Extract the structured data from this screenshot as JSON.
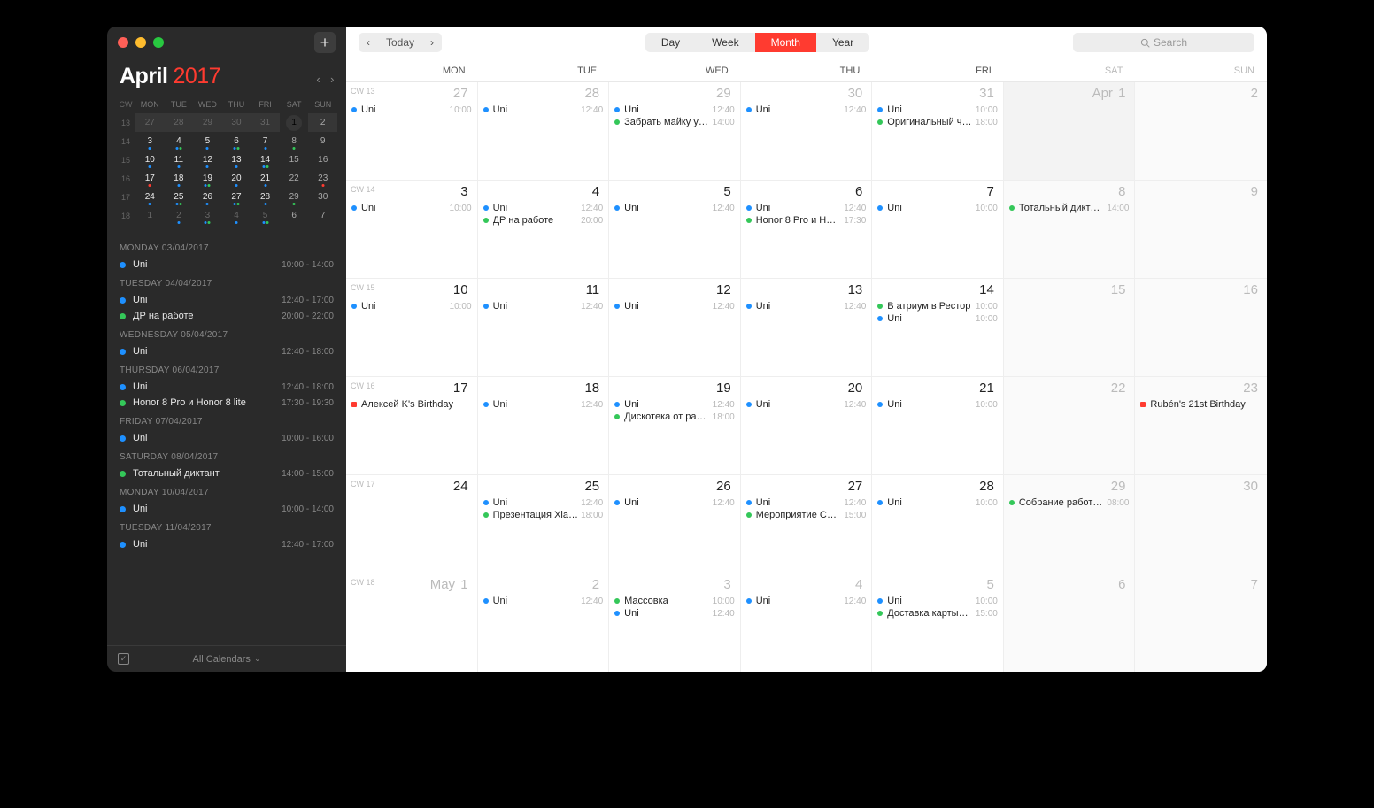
{
  "sidebar": {
    "month": "April",
    "year": "2017",
    "mini_header": [
      "CW",
      "MON",
      "TUE",
      "WED",
      "THU",
      "FRI",
      "SAT",
      "SUN"
    ],
    "mini_rows": [
      {
        "cw": "13",
        "days": [
          {
            "n": "27",
            "out": true,
            "dots": []
          },
          {
            "n": "28",
            "out": true,
            "dots": []
          },
          {
            "n": "29",
            "out": true,
            "dots": []
          },
          {
            "n": "30",
            "out": true,
            "dots": []
          },
          {
            "n": "31",
            "out": true,
            "dots": []
          },
          {
            "n": "1",
            "today": true,
            "dots": []
          },
          {
            "n": "2",
            "wknd": true,
            "dots": []
          }
        ],
        "sel": true
      },
      {
        "cw": "14",
        "days": [
          {
            "n": "3",
            "dots": [
              "#1e90ff"
            ]
          },
          {
            "n": "4",
            "dots": [
              "#1e90ff",
              "#34c759"
            ]
          },
          {
            "n": "5",
            "dots": [
              "#1e90ff"
            ]
          },
          {
            "n": "6",
            "dots": [
              "#1e90ff",
              "#34c759"
            ]
          },
          {
            "n": "7",
            "dots": [
              "#1e90ff"
            ]
          },
          {
            "n": "8",
            "wknd": true,
            "dots": [
              "#34c759"
            ]
          },
          {
            "n": "9",
            "wknd": true,
            "dots": []
          }
        ]
      },
      {
        "cw": "15",
        "days": [
          {
            "n": "10",
            "dots": [
              "#1e90ff"
            ]
          },
          {
            "n": "11",
            "dots": [
              "#1e90ff"
            ]
          },
          {
            "n": "12",
            "dots": [
              "#1e90ff"
            ]
          },
          {
            "n": "13",
            "dots": [
              "#1e90ff"
            ]
          },
          {
            "n": "14",
            "dots": [
              "#1e90ff",
              "#34c759"
            ]
          },
          {
            "n": "15",
            "wknd": true,
            "dots": []
          },
          {
            "n": "16",
            "wknd": true,
            "dots": []
          }
        ]
      },
      {
        "cw": "16",
        "days": [
          {
            "n": "17",
            "dots": [
              "#ff3b30"
            ]
          },
          {
            "n": "18",
            "dots": [
              "#1e90ff"
            ]
          },
          {
            "n": "19",
            "dots": [
              "#1e90ff",
              "#34c759"
            ]
          },
          {
            "n": "20",
            "dots": [
              "#1e90ff"
            ]
          },
          {
            "n": "21",
            "dots": [
              "#1e90ff"
            ]
          },
          {
            "n": "22",
            "wknd": true,
            "dots": []
          },
          {
            "n": "23",
            "wknd": true,
            "dots": [
              "#ff3b30"
            ]
          }
        ]
      },
      {
        "cw": "17",
        "days": [
          {
            "n": "24",
            "dots": [
              "#1e90ff"
            ]
          },
          {
            "n": "25",
            "dots": [
              "#1e90ff",
              "#34c759"
            ]
          },
          {
            "n": "26",
            "dots": [
              "#1e90ff"
            ]
          },
          {
            "n": "27",
            "dots": [
              "#1e90ff",
              "#34c759"
            ]
          },
          {
            "n": "28",
            "dots": [
              "#1e90ff"
            ]
          },
          {
            "n": "29",
            "wknd": true,
            "dots": [
              "#34c759"
            ]
          },
          {
            "n": "30",
            "wknd": true,
            "dots": []
          }
        ]
      },
      {
        "cw": "18",
        "days": [
          {
            "n": "1",
            "out": true,
            "dots": []
          },
          {
            "n": "2",
            "out": true,
            "dots": [
              "#1e90ff"
            ]
          },
          {
            "n": "3",
            "out": true,
            "dots": [
              "#1e90ff",
              "#34c759"
            ]
          },
          {
            "n": "4",
            "out": true,
            "dots": [
              "#1e90ff"
            ]
          },
          {
            "n": "5",
            "out": true,
            "dots": [
              "#1e90ff",
              "#34c759"
            ]
          },
          {
            "n": "6",
            "out": true,
            "wknd": true,
            "dots": []
          },
          {
            "n": "7",
            "out": true,
            "wknd": true,
            "dots": []
          }
        ]
      }
    ],
    "agenda": [
      {
        "type": "h",
        "text": "MONDAY 03/04/2017"
      },
      {
        "type": "e",
        "color": "#1e90ff",
        "label": "Uni",
        "time": "10:00 - 14:00"
      },
      {
        "type": "h",
        "text": "TUESDAY 04/04/2017"
      },
      {
        "type": "e",
        "color": "#1e90ff",
        "label": "Uni",
        "time": "12:40 - 17:00"
      },
      {
        "type": "e",
        "color": "#34c759",
        "label": "ДР на работе",
        "time": "20:00 - 22:00"
      },
      {
        "type": "h",
        "text": "WEDNESDAY 05/04/2017"
      },
      {
        "type": "e",
        "color": "#1e90ff",
        "label": "Uni",
        "time": "12:40 - 18:00"
      },
      {
        "type": "h",
        "text": "THURSDAY 06/04/2017"
      },
      {
        "type": "e",
        "color": "#1e90ff",
        "label": "Uni",
        "time": "12:40 - 18:00"
      },
      {
        "type": "e",
        "color": "#34c759",
        "label": "Honor 8 Pro и Honor 8 lite",
        "time": "17:30 - 19:30"
      },
      {
        "type": "h",
        "text": "FRIDAY 07/04/2017"
      },
      {
        "type": "e",
        "color": "#1e90ff",
        "label": "Uni",
        "time": "10:00 - 16:00"
      },
      {
        "type": "h",
        "text": "SATURDAY 08/04/2017"
      },
      {
        "type": "e",
        "color": "#34c759",
        "label": "Тотальный диктант",
        "time": "14:00 - 15:00"
      },
      {
        "type": "h",
        "text": "MONDAY 10/04/2017"
      },
      {
        "type": "e",
        "color": "#1e90ff",
        "label": "Uni",
        "time": "10:00 - 14:00"
      },
      {
        "type": "h",
        "text": "TUESDAY 11/04/2017"
      },
      {
        "type": "e",
        "color": "#1e90ff",
        "label": "Uni",
        "time": "12:40 - 17:00"
      }
    ],
    "footer_label": "All Calendars"
  },
  "toolbar": {
    "today": "Today",
    "views": [
      "Day",
      "Week",
      "Month",
      "Year"
    ],
    "active_view": 2,
    "search_placeholder": "Search"
  },
  "dow": [
    "MON",
    "TUE",
    "WED",
    "THU",
    "FRI",
    "SAT",
    "SUN"
  ],
  "weeks": [
    {
      "cw": "CW 13",
      "cells": [
        {
          "n": "27",
          "out": true,
          "ev": [
            {
              "c": "#1e90ff",
              "s": "b",
              "l": "Uni",
              "t": "10:00"
            }
          ]
        },
        {
          "n": "28",
          "out": true,
          "ev": [
            {
              "c": "#1e90ff",
              "s": "b",
              "l": "Uni",
              "t": "12:40"
            }
          ]
        },
        {
          "n": "29",
          "out": true,
          "ev": [
            {
              "c": "#1e90ff",
              "s": "b",
              "l": "Uni",
              "t": "12:40"
            },
            {
              "c": "#34c759",
              "s": "b",
              "l": "Забрать майку у…",
              "t": "14:00"
            }
          ]
        },
        {
          "n": "30",
          "out": true,
          "ev": [
            {
              "c": "#1e90ff",
              "s": "b",
              "l": "Uni",
              "t": "12:40"
            }
          ]
        },
        {
          "n": "31",
          "out": true,
          "ev": [
            {
              "c": "#1e90ff",
              "s": "b",
              "l": "Uni",
              "t": "10:00"
            },
            {
              "c": "#34c759",
              "s": "b",
              "l": "Оригинальный ч…",
              "t": "18:00"
            }
          ]
        },
        {
          "n": "1",
          "pre": "Apr",
          "wknd": true,
          "shade": true,
          "ev": []
        },
        {
          "n": "2",
          "wknd": true,
          "ev": []
        }
      ]
    },
    {
      "cw": "CW 14",
      "cells": [
        {
          "n": "3",
          "ev": [
            {
              "c": "#1e90ff",
              "s": "b",
              "l": "Uni",
              "t": "10:00"
            }
          ]
        },
        {
          "n": "4",
          "ev": [
            {
              "c": "#1e90ff",
              "s": "b",
              "l": "Uni",
              "t": "12:40"
            },
            {
              "c": "#34c759",
              "s": "b",
              "l": "ДР на работе",
              "t": "20:00"
            }
          ]
        },
        {
          "n": "5",
          "ev": [
            {
              "c": "#1e90ff",
              "s": "b",
              "l": "Uni",
              "t": "12:40"
            }
          ]
        },
        {
          "n": "6",
          "ev": [
            {
              "c": "#1e90ff",
              "s": "b",
              "l": "Uni",
              "t": "12:40"
            },
            {
              "c": "#34c759",
              "s": "b",
              "l": "Honor 8 Pro и Ho…",
              "t": "17:30"
            }
          ]
        },
        {
          "n": "7",
          "ev": [
            {
              "c": "#1e90ff",
              "s": "b",
              "l": "Uni",
              "t": "10:00"
            }
          ]
        },
        {
          "n": "8",
          "wknd": true,
          "ev": [
            {
              "c": "#34c759",
              "s": "b",
              "l": "Тотальный дикта…",
              "t": "14:00"
            }
          ]
        },
        {
          "n": "9",
          "wknd": true,
          "ev": []
        }
      ]
    },
    {
      "cw": "CW 15",
      "cells": [
        {
          "n": "10",
          "ev": [
            {
              "c": "#1e90ff",
              "s": "b",
              "l": "Uni",
              "t": "10:00"
            }
          ]
        },
        {
          "n": "11",
          "ev": [
            {
              "c": "#1e90ff",
              "s": "b",
              "l": "Uni",
              "t": "12:40"
            }
          ]
        },
        {
          "n": "12",
          "ev": [
            {
              "c": "#1e90ff",
              "s": "b",
              "l": "Uni",
              "t": "12:40"
            }
          ]
        },
        {
          "n": "13",
          "ev": [
            {
              "c": "#1e90ff",
              "s": "b",
              "l": "Uni",
              "t": "12:40"
            }
          ]
        },
        {
          "n": "14",
          "ev": [
            {
              "c": "#34c759",
              "s": "b",
              "l": "В атриум в Рестор",
              "t": "10:00"
            },
            {
              "c": "#1e90ff",
              "s": "b",
              "l": "Uni",
              "t": "10:00"
            }
          ]
        },
        {
          "n": "15",
          "wknd": true,
          "ev": []
        },
        {
          "n": "16",
          "wknd": true,
          "ev": []
        }
      ]
    },
    {
      "cw": "CW 16",
      "cells": [
        {
          "n": "17",
          "ev": [
            {
              "c": "#ff3b30",
              "s": "sq",
              "l": "Алексей K's Birthday",
              "t": ""
            }
          ]
        },
        {
          "n": "18",
          "ev": [
            {
              "c": "#1e90ff",
              "s": "b",
              "l": "Uni",
              "t": "12:40"
            }
          ]
        },
        {
          "n": "19",
          "ev": [
            {
              "c": "#1e90ff",
              "s": "b",
              "l": "Uni",
              "t": "12:40"
            },
            {
              "c": "#34c759",
              "s": "b",
              "l": "Дискотека от ра…",
              "t": "18:00"
            }
          ]
        },
        {
          "n": "20",
          "ev": [
            {
              "c": "#1e90ff",
              "s": "b",
              "l": "Uni",
              "t": "12:40"
            }
          ]
        },
        {
          "n": "21",
          "ev": [
            {
              "c": "#1e90ff",
              "s": "b",
              "l": "Uni",
              "t": "10:00"
            }
          ]
        },
        {
          "n": "22",
          "wknd": true,
          "ev": []
        },
        {
          "n": "23",
          "wknd": true,
          "ev": [
            {
              "c": "#ff3b30",
              "s": "sq",
              "l": "Rubén's 21st Birthday",
              "t": ""
            }
          ]
        }
      ]
    },
    {
      "cw": "CW 17",
      "cells": [
        {
          "n": "24",
          "ev": []
        },
        {
          "n": "25",
          "ev": [
            {
              "c": "#1e90ff",
              "s": "b",
              "l": "Uni",
              "t": "12:40"
            },
            {
              "c": "#34c759",
              "s": "b",
              "l": "Презентация Xia…",
              "t": "18:00"
            }
          ]
        },
        {
          "n": "26",
          "ev": [
            {
              "c": "#1e90ff",
              "s": "b",
              "l": "Uni",
              "t": "12:40"
            }
          ]
        },
        {
          "n": "27",
          "ev": [
            {
              "c": "#1e90ff",
              "s": "b",
              "l": "Uni",
              "t": "12:40"
            },
            {
              "c": "#34c759",
              "s": "b",
              "l": "Мероприятие Са…",
              "t": "15:00"
            }
          ]
        },
        {
          "n": "28",
          "ev": [
            {
              "c": "#1e90ff",
              "s": "b",
              "l": "Uni",
              "t": "10:00"
            }
          ]
        },
        {
          "n": "29",
          "wknd": true,
          "ev": [
            {
              "c": "#34c759",
              "s": "b",
              "l": "Собрание работ…",
              "t": "08:00"
            }
          ]
        },
        {
          "n": "30",
          "wknd": true,
          "ev": []
        }
      ]
    },
    {
      "cw": "CW 18",
      "cells": [
        {
          "n": "1",
          "pre": "May",
          "out": true,
          "ev": []
        },
        {
          "n": "2",
          "out": true,
          "ev": [
            {
              "c": "#1e90ff",
              "s": "b",
              "l": "Uni",
              "t": "12:40"
            }
          ]
        },
        {
          "n": "3",
          "out": true,
          "ev": [
            {
              "c": "#34c759",
              "s": "b",
              "l": "Массовка",
              "t": "10:00"
            },
            {
              "c": "#1e90ff",
              "s": "b",
              "l": "Uni",
              "t": "12:40"
            }
          ]
        },
        {
          "n": "4",
          "out": true,
          "ev": [
            {
              "c": "#1e90ff",
              "s": "b",
              "l": "Uni",
              "t": "12:40"
            }
          ]
        },
        {
          "n": "5",
          "out": true,
          "ev": [
            {
              "c": "#1e90ff",
              "s": "b",
              "l": "Uni",
              "t": "10:00"
            },
            {
              "c": "#34c759",
              "s": "b",
              "l": "Доставка карты…",
              "t": "15:00"
            }
          ]
        },
        {
          "n": "6",
          "out": true,
          "wknd": true,
          "ev": []
        },
        {
          "n": "7",
          "out": true,
          "wknd": true,
          "ev": []
        }
      ]
    }
  ]
}
